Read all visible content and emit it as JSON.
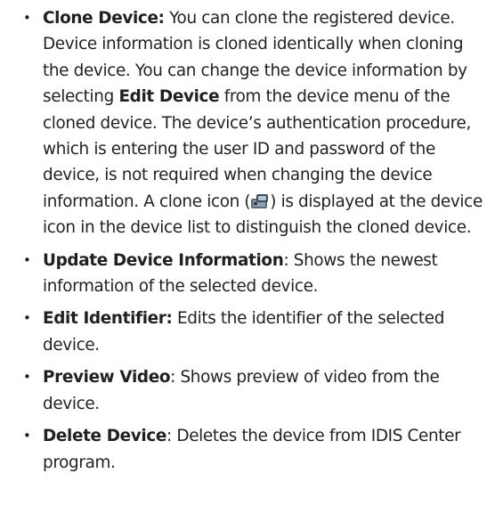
{
  "items": [
    {
      "term": "Clone Device:",
      "text_a": " You can clone the registered device. Device information is cloned identically when cloning the device. You can change the device information by selecting ",
      "emph": "Edit Device",
      "text_b": " from the device menu of the cloned device. The device’s authentication procedure, which is entering the user ID and password of the device, is not required when changing the device information. A clone icon (",
      "icon": "clone-device-icon",
      "text_c": ") is displayed at the device icon in the device list to distinguish the cloned device."
    },
    {
      "term": "Update Device Information",
      "text": ": Shows the newest information of the selected device."
    },
    {
      "term": "Edit Identifier:",
      "text": " Edits the identifier of the selected device."
    },
    {
      "term": "Preview Video",
      "text": ": Shows preview of video from the device."
    },
    {
      "term": "Delete Device",
      "text": ": Deletes the device from IDIS Center program."
    }
  ],
  "bullet_glyph": "•"
}
